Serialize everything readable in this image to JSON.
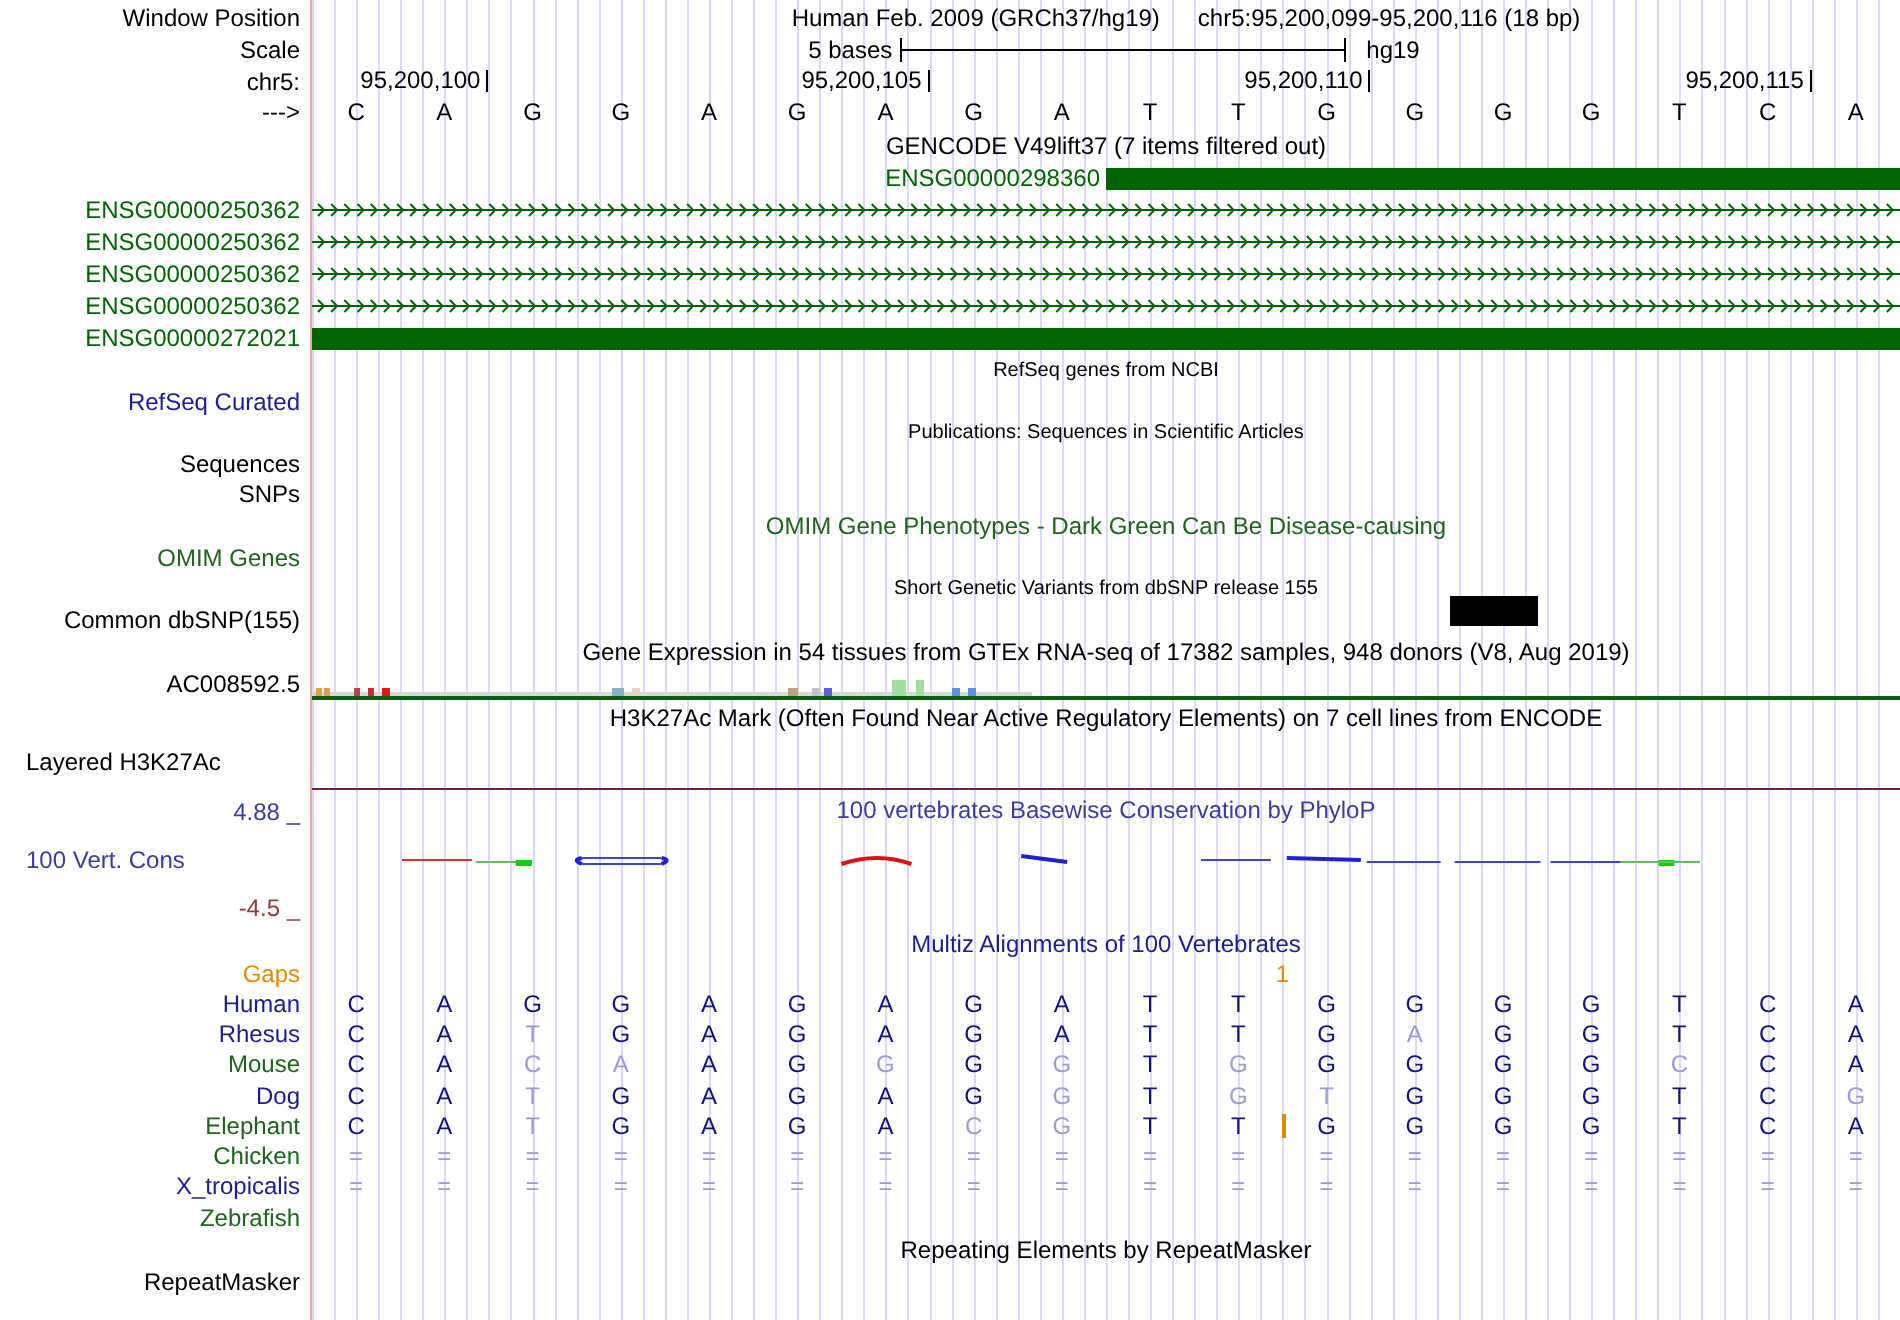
{
  "header": {
    "label": "Window Position",
    "assembly": "Human Feb. 2009 (GRCh37/hg19)",
    "position": "chr5:95,200,099-95,200,116 (18 bp)"
  },
  "scale": {
    "label": "Scale",
    "bar_label": "5 bases",
    "assembly": "hg19"
  },
  "ruler": {
    "label": "chr5:",
    "ticks": [
      "95,200,100",
      "95,200,105",
      "95,200,110",
      "95,200,115"
    ]
  },
  "sequence": {
    "label": "--->",
    "bases": [
      "C",
      "A",
      "G",
      "G",
      "A",
      "G",
      "A",
      "G",
      "A",
      "T",
      "T",
      "G",
      "G",
      "G",
      "G",
      "T",
      "C",
      "A"
    ]
  },
  "tracks": [
    {
      "kind": "title",
      "text": "GENCODE V49lift37 (7 items filtered out)",
      "color": "#000000",
      "small": false
    },
    {
      "kind": "inline_gene",
      "name": "ENSG00000298360",
      "color": "#006400"
    },
    {
      "kind": "gene",
      "name": "ENSG00000250362",
      "color": "#006400"
    },
    {
      "kind": "gene",
      "name": "ENSG00000250362",
      "color": "#006400"
    },
    {
      "kind": "gene",
      "name": "ENSG00000250362",
      "color": "#006400"
    },
    {
      "kind": "gene",
      "name": "ENSG00000250362",
      "color": "#006400"
    },
    {
      "kind": "block_gene",
      "name": "ENSG00000272021",
      "color": "#006400"
    },
    {
      "kind": "title",
      "text": "RefSeq genes from NCBI",
      "color": "#000000",
      "small": true
    },
    {
      "kind": "label",
      "text": "RefSeq Curated",
      "color": "#1c1c8c"
    },
    {
      "kind": "title",
      "text": "Publications: Sequences in Scientific Articles",
      "color": "#000000",
      "small": true
    },
    {
      "kind": "label",
      "text": "Sequences",
      "color": "#000000"
    },
    {
      "kind": "label",
      "text": "SNPs",
      "color": "#000000"
    },
    {
      "kind": "title",
      "text": "OMIM Gene Phenotypes - Dark Green Can Be Disease-causing",
      "color": "#1c641c",
      "small": false
    },
    {
      "kind": "label",
      "text": "OMIM Genes",
      "color": "#1c641c"
    },
    {
      "kind": "title",
      "text": "Short Genetic Variants from dbSNP release 155",
      "color": "#000000",
      "small": true
    },
    {
      "kind": "snp_label",
      "text": "Common dbSNP(155)",
      "color": "#000000"
    },
    {
      "kind": "title",
      "text": "Gene Expression in 54 tissues from GTEx RNA-seq of 17382 samples, 948 donors (V8, Aug 2019)",
      "color": "#000000",
      "small": false
    },
    {
      "kind": "expression_label",
      "text": "AC008592.5",
      "color": "#000000"
    },
    {
      "kind": "title",
      "text": "H3K27Ac Mark (Often Found Near Active Regulatory Elements) on 7 cell lines from ENCODE",
      "color": "#000000",
      "small": false
    },
    {
      "kind": "layered_label",
      "text": "Layered H3K27Ac",
      "color": "#000000"
    },
    {
      "kind": "wiggle",
      "title": "100 vertebrates Basewise Conservation by PhyloP",
      "label": "100 Vert. Cons",
      "max": "4.88 _",
      "min": "-4.5 _",
      "color": "#3c3c9c"
    },
    {
      "kind": "title",
      "text": "Multiz Alignments of 100 Vertebrates",
      "color": "#1c1c8c",
      "small": false
    },
    {
      "kind": "gaps",
      "label": "Gaps",
      "count": "1",
      "color": "#e08c00"
    },
    {
      "kind": "species",
      "name": "Human",
      "color": "#1c1c8c",
      "bases": [
        {
          "base": "C",
          "faded": false
        },
        {
          "base": "A",
          "faded": false
        },
        {
          "base": "G",
          "faded": false
        },
        {
          "base": "G",
          "faded": false
        },
        {
          "base": "A",
          "faded": false
        },
        {
          "base": "G",
          "faded": false
        },
        {
          "base": "A",
          "faded": false
        },
        {
          "base": "G",
          "faded": false
        },
        {
          "base": "A",
          "faded": false
        },
        {
          "base": "T",
          "faded": false
        },
        {
          "base": "T",
          "faded": false
        },
        {
          "base": "G",
          "faded": false
        },
        {
          "base": "G",
          "faded": false
        },
        {
          "base": "G",
          "faded": false
        },
        {
          "base": "G",
          "faded": false
        },
        {
          "base": "T",
          "faded": false
        },
        {
          "base": "C",
          "faded": false
        },
        {
          "base": "A",
          "faded": false
        }
      ]
    },
    {
      "kind": "species",
      "name": "Rhesus",
      "color": "#1c1c8c",
      "bases": [
        {
          "base": "C",
          "faded": false
        },
        {
          "base": "A",
          "faded": false
        },
        {
          "base": "T",
          "faded": true
        },
        {
          "base": "G",
          "faded": false
        },
        {
          "base": "A",
          "faded": false
        },
        {
          "base": "G",
          "faded": false
        },
        {
          "base": "A",
          "faded": false
        },
        {
          "base": "G",
          "faded": false
        },
        {
          "base": "A",
          "faded": false
        },
        {
          "base": "T",
          "faded": false
        },
        {
          "base": "T",
          "faded": false
        },
        {
          "base": "G",
          "faded": false
        },
        {
          "base": "A",
          "faded": true
        },
        {
          "base": "G",
          "faded": false
        },
        {
          "base": "G",
          "faded": false
        },
        {
          "base": "T",
          "faded": false
        },
        {
          "base": "C",
          "faded": false
        },
        {
          "base": "A",
          "faded": false
        }
      ]
    },
    {
      "kind": "species",
      "name": "Mouse",
      "color": "#1c641c",
      "bases": [
        {
          "base": "C",
          "faded": false
        },
        {
          "base": "A",
          "faded": false
        },
        {
          "base": "C",
          "faded": true
        },
        {
          "base": "A",
          "faded": true
        },
        {
          "base": "A",
          "faded": false
        },
        {
          "base": "G",
          "faded": false
        },
        {
          "base": "G",
          "faded": true
        },
        {
          "base": "G",
          "faded": false
        },
        {
          "base": "G",
          "faded": true
        },
        {
          "base": "T",
          "faded": false
        },
        {
          "base": "G",
          "faded": true
        },
        {
          "base": "G",
          "faded": false
        },
        {
          "base": "G",
          "faded": false
        },
        {
          "base": "G",
          "faded": false
        },
        {
          "base": "G",
          "faded": false
        },
        {
          "base": "C",
          "faded": true
        },
        {
          "base": "C",
          "faded": false
        },
        {
          "base": "A",
          "faded": false
        }
      ]
    },
    {
      "kind": "species",
      "name": "Dog",
      "color": "#1c1c8c",
      "bases": [
        {
          "base": "C",
          "faded": false
        },
        {
          "base": "A",
          "faded": false
        },
        {
          "base": "T",
          "faded": true
        },
        {
          "base": "G",
          "faded": false
        },
        {
          "base": "A",
          "faded": false
        },
        {
          "base": "G",
          "faded": false
        },
        {
          "base": "A",
          "faded": false
        },
        {
          "base": "G",
          "faded": false
        },
        {
          "base": "G",
          "faded": true
        },
        {
          "base": "T",
          "faded": false
        },
        {
          "base": "G",
          "faded": true
        },
        {
          "base": "T",
          "faded": true
        },
        {
          "base": "G",
          "faded": false
        },
        {
          "base": "G",
          "faded": false
        },
        {
          "base": "G",
          "faded": false
        },
        {
          "base": "T",
          "faded": false
        },
        {
          "base": "C",
          "faded": false
        },
        {
          "base": "G",
          "faded": true
        }
      ]
    },
    {
      "kind": "species",
      "name": "Elephant",
      "color": "#1c641c",
      "bases": [
        {
          "base": "C",
          "faded": false
        },
        {
          "base": "A",
          "faded": false
        },
        {
          "base": "T",
          "faded": true
        },
        {
          "base": "G",
          "faded": false
        },
        {
          "base": "A",
          "faded": false
        },
        {
          "base": "G",
          "faded": false
        },
        {
          "base": "A",
          "faded": false
        },
        {
          "base": "C",
          "faded": true
        },
        {
          "base": "G",
          "faded": true
        },
        {
          "base": "T",
          "faded": false
        },
        {
          "base": "T",
          "faded": false,
          "insertion_after": true
        },
        {
          "base": "G",
          "faded": false
        },
        {
          "base": "G",
          "faded": false
        },
        {
          "base": "G",
          "faded": false
        },
        {
          "base": "G",
          "faded": false
        },
        {
          "base": "T",
          "faded": false
        },
        {
          "base": "C",
          "faded": false
        },
        {
          "base": "A",
          "faded": false
        }
      ]
    },
    {
      "kind": "species",
      "name": "Chicken",
      "color": "#1c641c",
      "bases": [
        {
          "base": "=",
          "faded": true
        },
        {
          "base": "=",
          "faded": true
        },
        {
          "base": "=",
          "faded": true
        },
        {
          "base": "=",
          "faded": true
        },
        {
          "base": "=",
          "faded": true
        },
        {
          "base": "=",
          "faded": true
        },
        {
          "base": "=",
          "faded": true
        },
        {
          "base": "=",
          "faded": true
        },
        {
          "base": "=",
          "faded": true
        },
        {
          "base": "=",
          "faded": true
        },
        {
          "base": "=",
          "faded": true
        },
        {
          "base": "=",
          "faded": true
        },
        {
          "base": "=",
          "faded": true
        },
        {
          "base": "=",
          "faded": true
        },
        {
          "base": "=",
          "faded": true
        },
        {
          "base": "=",
          "faded": true
        },
        {
          "base": "=",
          "faded": true
        },
        {
          "base": "=",
          "faded": true
        }
      ]
    },
    {
      "kind": "species",
      "name": "X_tropicalis",
      "color": "#1c1c8c",
      "bases": [
        {
          "base": "=",
          "faded": true
        },
        {
          "base": "=",
          "faded": true
        },
        {
          "base": "=",
          "faded": true
        },
        {
          "base": "=",
          "faded": true
        },
        {
          "base": "=",
          "faded": true
        },
        {
          "base": "=",
          "faded": true
        },
        {
          "base": "=",
          "faded": true
        },
        {
          "base": "=",
          "faded": true
        },
        {
          "base": "=",
          "faded": true
        },
        {
          "base": "=",
          "faded": true
        },
        {
          "base": "=",
          "faded": true
        },
        {
          "base": "=",
          "faded": true
        },
        {
          "base": "=",
          "faded": true
        },
        {
          "base": "=",
          "faded": true
        },
        {
          "base": "=",
          "faded": true
        },
        {
          "base": "=",
          "faded": true
        },
        {
          "base": "=",
          "faded": true
        },
        {
          "base": "=",
          "faded": true
        }
      ]
    },
    {
      "kind": "species",
      "name": "Zebrafish",
      "color": "#1c641c"
    },
    {
      "kind": "title",
      "text": "Repeating Elements by RepeatMasker",
      "color": "#000000",
      "small": false
    },
    {
      "kind": "label",
      "text": "RepeatMasker",
      "color": "#000000"
    }
  ]
}
